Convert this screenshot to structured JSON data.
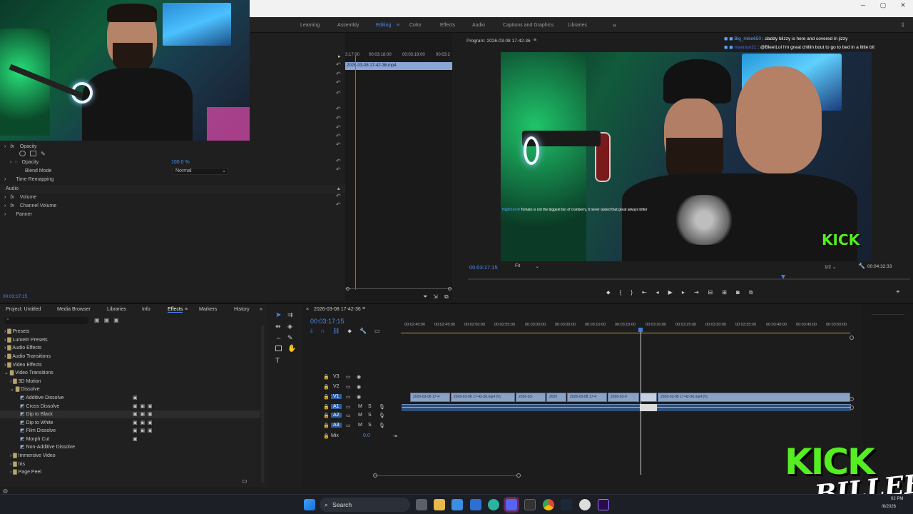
{
  "topnav": {
    "tabs": [
      "Learning",
      "Assembly",
      "Editing",
      "Color",
      "Effects",
      "Audio",
      "Captions and Graphics",
      "Libraries"
    ],
    "more": "»"
  },
  "effect_controls": {
    "rows": [
      {
        "label": "Opacity"
      },
      {
        "label": "Opacity",
        "value": "100.0 %"
      },
      {
        "label": "Blend Mode",
        "value": "Normal"
      },
      {
        "label": "Time Remapping"
      },
      {
        "label": "Audio"
      },
      {
        "label": "Volume"
      },
      {
        "label": "Channel Volume"
      },
      {
        "label": "Panner"
      }
    ],
    "timecode": "00:03:17:15",
    "mini_ruler": [
      "3:17:00",
      "00:03:18:00",
      "00:03:19:00",
      "00:03:2"
    ],
    "mini_clip": "2026-03-08 17-42-36.mp4"
  },
  "program": {
    "title": "Program: 2026-03-08 17-42-36",
    "timecode": "00:03:17:15",
    "fit": "Fit",
    "resolution": "1/2",
    "duration": "00:04:32:33",
    "caption_user": "NightZero8",
    "caption_text": "Tomato is not the biggest fan of cranberry, it never tasted that great always bitter"
  },
  "chat": [
    {
      "user": "Big_mike650",
      "text": "daddy blizzy is here and covered in jizzy",
      "color": "#5aa8ff"
    },
    {
      "user": "maxroor21",
      "text": "@BleetLol I'm great chillin bout to go to bed in a little bit",
      "color": "#4b6cff"
    }
  ],
  "project": {
    "tabs": [
      "Project: Untitled",
      "Media Browser",
      "Libraries",
      "Info",
      "Effects",
      "Markers",
      "History"
    ],
    "active_tab": "Effects",
    "tree": [
      {
        "label": "Presets",
        "level": 0
      },
      {
        "label": "Lumetri Presets",
        "level": 0
      },
      {
        "label": "Audio Effects",
        "level": 0
      },
      {
        "label": "Audio Transitions",
        "level": 0
      },
      {
        "label": "Video Effects",
        "level": 0
      },
      {
        "label": "Video Transitions",
        "level": 0
      },
      {
        "label": "3D Motion",
        "level": 1
      },
      {
        "label": "Dissolve",
        "level": 1
      },
      {
        "label": "Additive Dissolve",
        "level": 2
      },
      {
        "label": "Cross Dissolve",
        "level": 2
      },
      {
        "label": "Dip to Black",
        "level": 2
      },
      {
        "label": "Dip to White",
        "level": 2
      },
      {
        "label": "Film Dissolve",
        "level": 2
      },
      {
        "label": "Morph Cut",
        "level": 2
      },
      {
        "label": "Non-Additive Dissolve",
        "level": 2
      },
      {
        "label": "Immersive Video",
        "level": 1
      },
      {
        "label": "Iris",
        "level": 1
      },
      {
        "label": "Page Peel",
        "level": 1
      }
    ]
  },
  "sequence": {
    "name": "2026-03-08 17-42-36",
    "timecode": "00:03:17:15",
    "ruler": [
      "00:02:40:00",
      "00:02:45:00",
      "00:02:50:00",
      "00:02:55:00",
      "00:03:00:00",
      "00:03:05:00",
      "00:03:10:00",
      "00:03:15:00",
      "00:03:20:00",
      "00:03:25:00",
      "00:03:30:00",
      "00:03:35:00",
      "00:03:40:00",
      "00:03:45:00",
      "00:03:50:00"
    ],
    "tracks": [
      "V3",
      "V2",
      "V1",
      "A1",
      "A2",
      "A3"
    ],
    "mix_label": "Mix",
    "mix_value": "0.0",
    "clips": [
      "2026-03-08 17-4",
      "2026-03-08 17-42-36.mp4 [V]",
      "2026-03-",
      "2026",
      "2026-03-08 17-4",
      "2026-03-0",
      "",
      "2026-03-08 17-42-36.mp4 [V]"
    ]
  },
  "taskbar": {
    "search": "Search",
    "clock_time": "02 PM",
    "clock_date": "/8/2026"
  },
  "overlay": {
    "logo_top": "KICK",
    "logo_bottom": "BILLEH"
  }
}
